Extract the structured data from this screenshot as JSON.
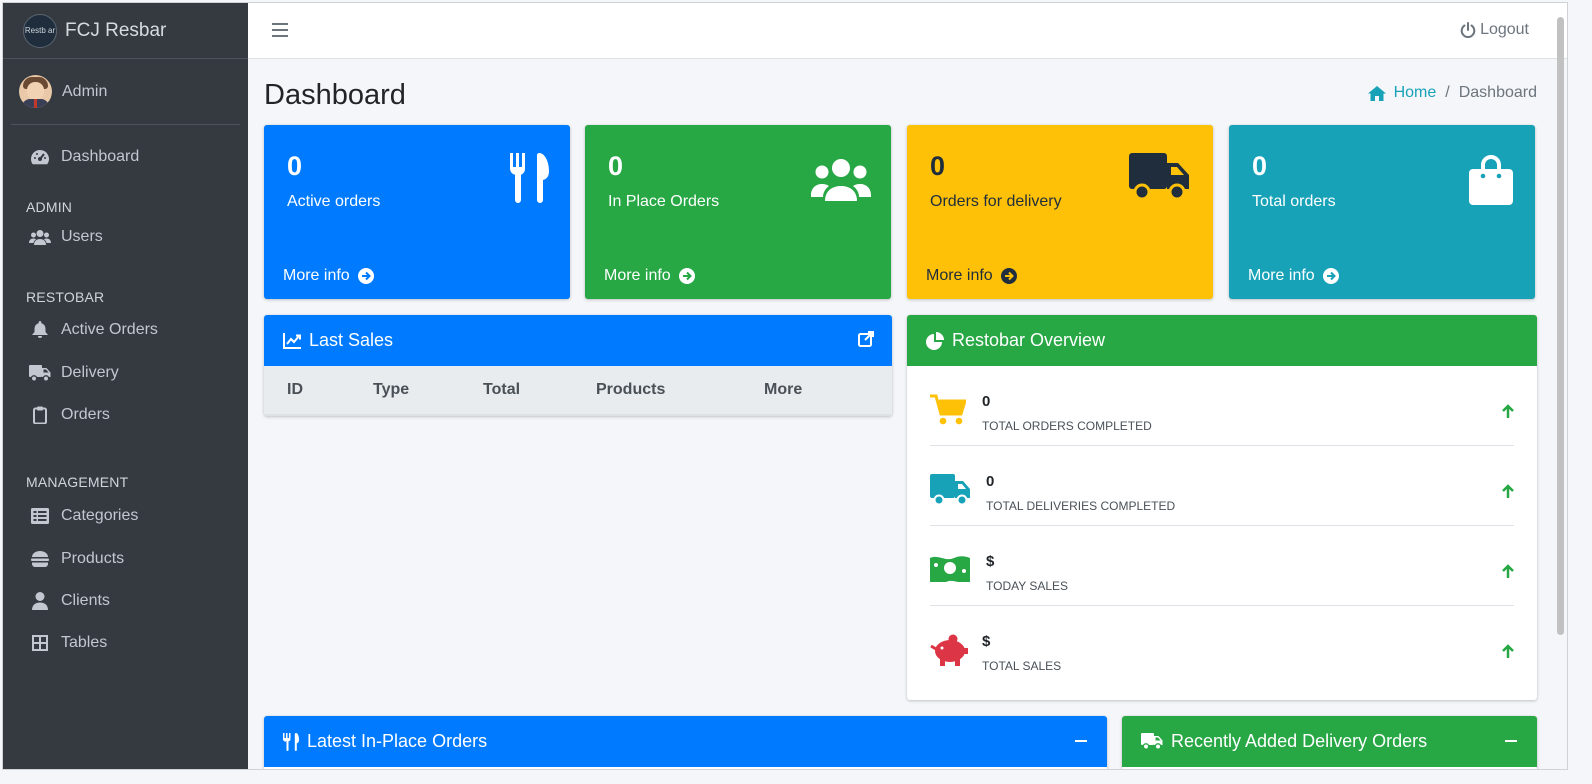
{
  "brand": {
    "name": "FCJ Resbar",
    "logo_text": "Restb ar"
  },
  "user": {
    "name": "Admin"
  },
  "sidebar": {
    "items": [
      {
        "label": "Dashboard",
        "icon": "tachometer-icon"
      },
      {
        "header": "ADMIN"
      },
      {
        "label": "Users",
        "icon": "users-icon"
      },
      {
        "header": "RESTOBAR"
      },
      {
        "label": "Active Orders",
        "icon": "bell-icon"
      },
      {
        "label": "Delivery",
        "icon": "truck-icon"
      },
      {
        "label": "Orders",
        "icon": "clipboard-icon"
      },
      {
        "header": "MANAGEMENT"
      },
      {
        "label": "Categories",
        "icon": "list-icon"
      },
      {
        "label": "Products",
        "icon": "hamburger-food-icon"
      },
      {
        "label": "Clients",
        "icon": "user-icon"
      },
      {
        "label": "Tables",
        "icon": "table-grid-icon"
      }
    ]
  },
  "topbar": {
    "logout_label": "Logout"
  },
  "page": {
    "title": "Dashboard"
  },
  "breadcrumb": {
    "home": "Home",
    "separator": "/",
    "current": "Dashboard"
  },
  "boxes": [
    {
      "value": "0",
      "label": "Active orders",
      "more": "More info",
      "color": "#007bff",
      "icon": "utensils-icon"
    },
    {
      "value": "0",
      "label": "In Place Orders",
      "more": "More info",
      "color": "#28a745",
      "icon": "users-icon"
    },
    {
      "value": "0",
      "label": "Orders for delivery",
      "more": "More info",
      "color": "#ffc107",
      "icon": "truck-icon"
    },
    {
      "value": "0",
      "label": "Total orders",
      "more": "More info",
      "color": "#17a2b8",
      "icon": "shopping-bag-icon"
    }
  ],
  "last_sales": {
    "title": "Last Sales",
    "columns": [
      "ID",
      "Type",
      "Total",
      "Products",
      "More"
    ]
  },
  "overview": {
    "title": "Restobar Overview",
    "rows": [
      {
        "value": "0",
        "label": "TOTAL ORDERS COMPLETED",
        "icon": "cart-icon",
        "color": "#ffc107"
      },
      {
        "value": "0",
        "label": "TOTAL DELIVERIES COMPLETED",
        "icon": "truck-icon",
        "color": "#17a2b8"
      },
      {
        "value": "$",
        "label": "TODAY SALES",
        "icon": "money-bill-icon",
        "color": "#28a745"
      },
      {
        "value": "$",
        "label": "TOTAL SALES",
        "icon": "piggy-bank-icon",
        "color": "#dc3545"
      }
    ]
  },
  "latest_inplace": {
    "title": "Latest In-Place Orders"
  },
  "recent_delivery": {
    "title": "Recently Added Delivery Orders"
  },
  "colors": {
    "sidebar": "#343a40",
    "primary": "#007bff",
    "success": "#28a745",
    "warning": "#ffc107",
    "info": "#17a2b8",
    "danger": "#dc3545"
  }
}
